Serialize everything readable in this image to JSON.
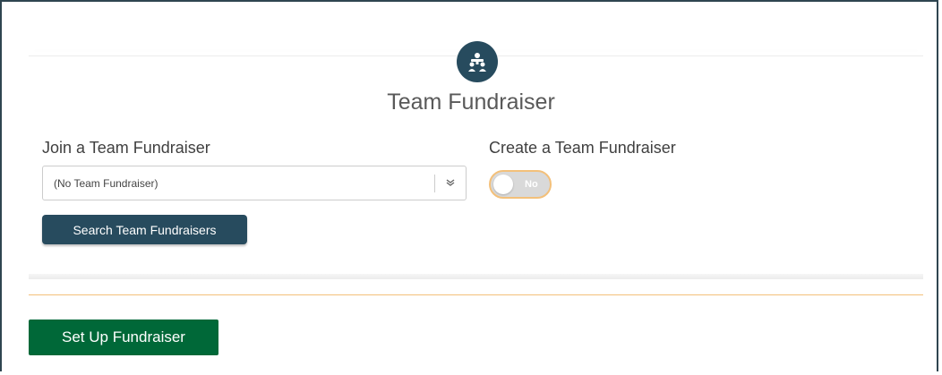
{
  "section": {
    "title": "Team Fundraiser",
    "icon": "team-icon"
  },
  "join": {
    "label": "Join a Team Fundraiser",
    "selected_value": "(No Team Fundraiser)",
    "search_button_label": "Search Team Fundraisers"
  },
  "create": {
    "label": "Create a Team Fundraiser",
    "toggle_text": "No",
    "toggle_on": false
  },
  "footer": {
    "setup_button_label": "Set Up Fundraiser"
  },
  "colors": {
    "primary": "#274b5e",
    "success": "#006838",
    "accent": "#f3c07a"
  }
}
